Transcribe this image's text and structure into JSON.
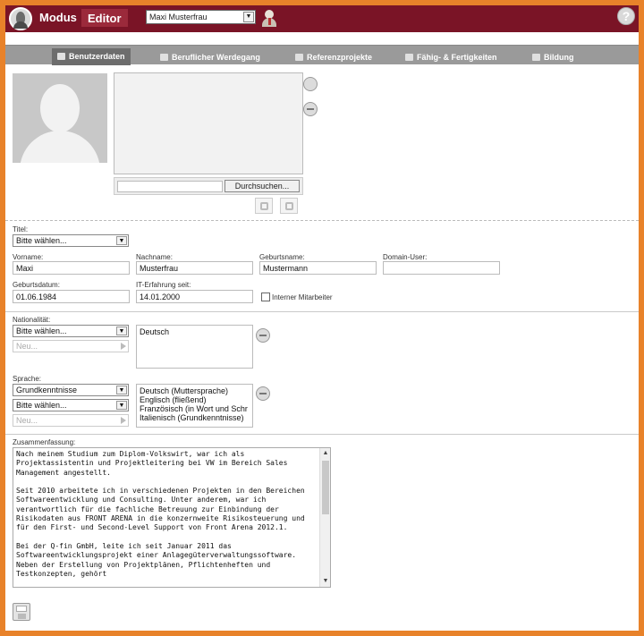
{
  "app": {
    "brand_primary": "Modus",
    "brand_secondary": "Editor",
    "help_glyph": "?",
    "accent_color": "#7a1426",
    "frame_color": "#e8822a"
  },
  "header": {
    "user_selector": {
      "value": "Maxi Musterfrau",
      "arrow": "▼"
    },
    "user_icon": "user-icon"
  },
  "tabs": [
    {
      "label": "Benutzerdaten",
      "active": true
    },
    {
      "label": "Beruflicher Werdegang",
      "active": false
    },
    {
      "label": "Referenzprojekte",
      "active": false
    },
    {
      "label": "Fähig- & Fertigkeiten",
      "active": false
    },
    {
      "label": "Bildung",
      "active": false
    }
  ],
  "photo": {
    "browse_label": "Durchsuchen..."
  },
  "form": {
    "titel": {
      "label": "Titel:",
      "value": "Bitte wählen..."
    },
    "vorname": {
      "label": "Vorname:",
      "value": "Maxi"
    },
    "nachname": {
      "label": "Nachname:",
      "value": "Musterfrau"
    },
    "geburtsname": {
      "label": "Geburtsname:",
      "value": "Mustermann"
    },
    "domain_user": {
      "label": "Domain-User:",
      "value": ""
    },
    "geburtsdatum": {
      "label": "Geburtsdatum:",
      "value": "01.06.1984"
    },
    "it_erfahrung": {
      "label": "IT-Erfahrung seit:",
      "value": "14.01.2000"
    },
    "interner_mitarbeiter": {
      "label": "Interner Mitarbeiter",
      "checked": false
    },
    "nationalitaet": {
      "label": "Nationalität:",
      "select_value": "Bitte wählen...",
      "new_placeholder": "Neu...",
      "list": [
        "Deutsch"
      ]
    },
    "sprache": {
      "label": "Sprache:",
      "level_value": "Grundkenntnisse",
      "select_value": "Bitte wählen...",
      "new_placeholder": "Neu...",
      "list": [
        "Deutsch (Muttersprache)",
        "Englisch (fließend)",
        "Französisch (in Wort und Schr",
        "Italienisch (Grundkenntnisse)"
      ]
    },
    "zusammenfassung": {
      "label": "Zusammenfassung:",
      "text": "Nach meinem Studium zum Diplom-Volkswirt, war ich als Projektassistentin und Projektleitering bei VW im Bereich Sales Management angestellt.\n\nSeit 2010 arbeitete ich in verschiedenen Projekten in den Bereichen Softwareentwicklung und Consulting. Unter anderem, war ich verantwortlich für die fachliche Betreuung zur Einbindung der Risikodaten aus FRONT ARENA in die konzernweite Risikosteuerung und für den First- und Second-Level Support von Front Arena 2012.1.\n\nBei der Q-fin GmbH, leite ich seit Januar 2011 das Softwareentwicklungsprojekt einer Anlagegüterverwaltungssoftware. Neben der Erstellung von Projektplänen, Pflichtenheften und Testkonzepten, gehört"
    }
  },
  "footer": {
    "save_icon": "save-icon"
  }
}
